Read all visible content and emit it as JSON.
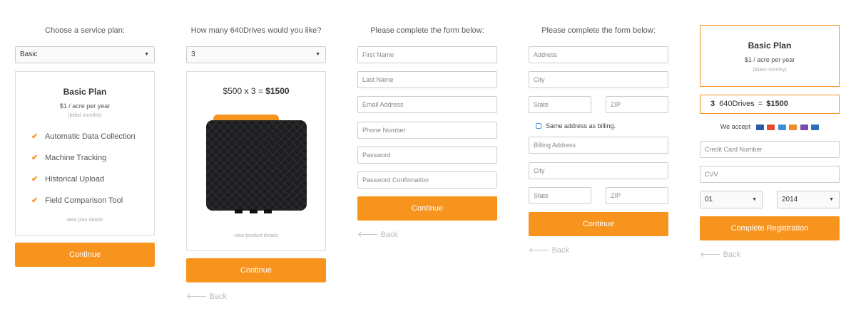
{
  "step1": {
    "heading": "Choose a service plan:",
    "select_value": "Basic",
    "plan_title": "Basic Plan",
    "plan_price": "$1 / acre per year",
    "plan_note": "(billed monthly)",
    "features": [
      "Automatic Data Collection",
      "Machine Tracking",
      "Historical Upload",
      "Field Comparison Tool"
    ],
    "details_link": "view plan details",
    "continue_label": "Continue"
  },
  "step2": {
    "heading": "How many 640Drives would you like?",
    "select_value": "3",
    "price_prefix": "$500 x 3 = ",
    "price_total": "$1500",
    "details_link": "view product details",
    "continue_label": "Continue",
    "back_label": "Back"
  },
  "step3": {
    "heading": "Please complete the form below:",
    "placeholders": [
      "First Name",
      "Last Name",
      "Email Address",
      "Phone Number",
      "Password",
      "Password Confirmation"
    ],
    "continue_label": "Continue",
    "back_label": "Back"
  },
  "step4": {
    "heading": "Please complete the form below:",
    "address_placeholder": "Address",
    "city_placeholder": "City",
    "state_placeholder": "State",
    "zip_placeholder": "ZIP",
    "same_address_label": "Same address as billing.",
    "billing_address_placeholder": "Billing Address",
    "billing_city_placeholder": "City",
    "billing_state_placeholder": "State",
    "billing_zip_placeholder": "ZIP",
    "continue_label": "Continue",
    "back_label": "Back"
  },
  "step5": {
    "plan_title": "Basic Plan",
    "plan_price": "$1 / acre per year",
    "plan_note": "(billed monthly)",
    "qty": "3",
    "product": "640Drives",
    "equals": "=",
    "total": "$1500",
    "we_accept": "We accept",
    "card_icons": [
      "visa-icon",
      "mastercard-icon",
      "amex-icon",
      "discover-icon",
      "card-icon",
      "paypal-icon"
    ],
    "cc_placeholder": "Credit Card Number",
    "cvv_placeholder": "CVV",
    "month_value": "01",
    "year_value": "2014",
    "complete_label": "Complete Registration",
    "back_label": "Back"
  },
  "colors": {
    "accent": "#f7941e",
    "border": "#cccccc",
    "muted": "#aaaaaa"
  }
}
